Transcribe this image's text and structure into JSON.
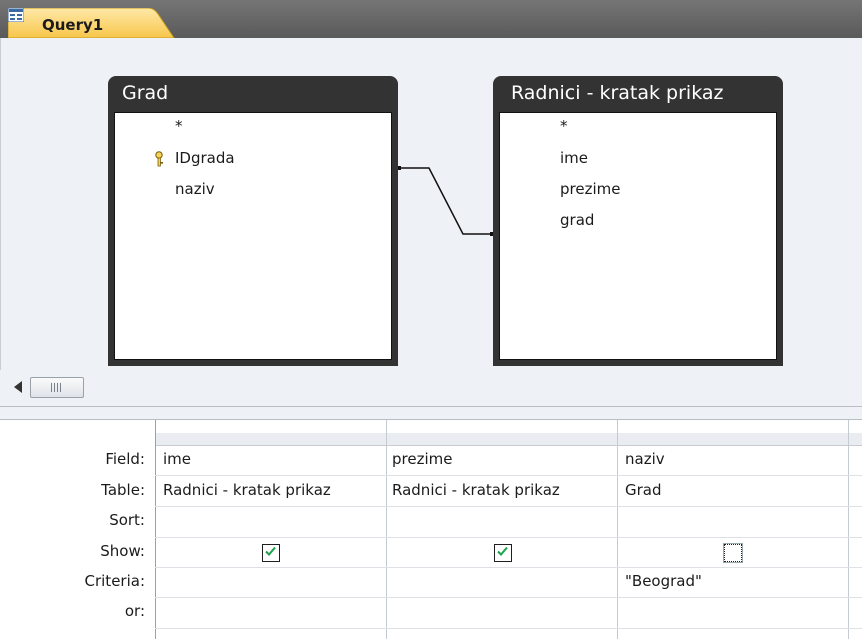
{
  "tab": {
    "title": "Query1"
  },
  "tables": [
    {
      "title": "Grad",
      "fields": [
        "*",
        "IDgrada",
        "naziv"
      ],
      "key_field": "IDgrada"
    },
    {
      "title": "Radnici - kratak prikaz",
      "fields": [
        "*",
        "ime",
        "prezime",
        "grad"
      ]
    }
  ],
  "grid": {
    "row_labels": [
      "Field:",
      "Table:",
      "Sort:",
      "Show:",
      "Criteria:",
      "or:"
    ],
    "columns": [
      {
        "field": "ime",
        "table": "Radnici - kratak prikaz",
        "sort": "",
        "show": true,
        "criteria": ""
      },
      {
        "field": "prezime",
        "table": "Radnici - kratak prikaz",
        "sort": "",
        "show": true,
        "criteria": ""
      },
      {
        "field": "naziv",
        "table": "Grad",
        "sort": "",
        "show": false,
        "criteria": "\"Beograd\""
      }
    ]
  }
}
